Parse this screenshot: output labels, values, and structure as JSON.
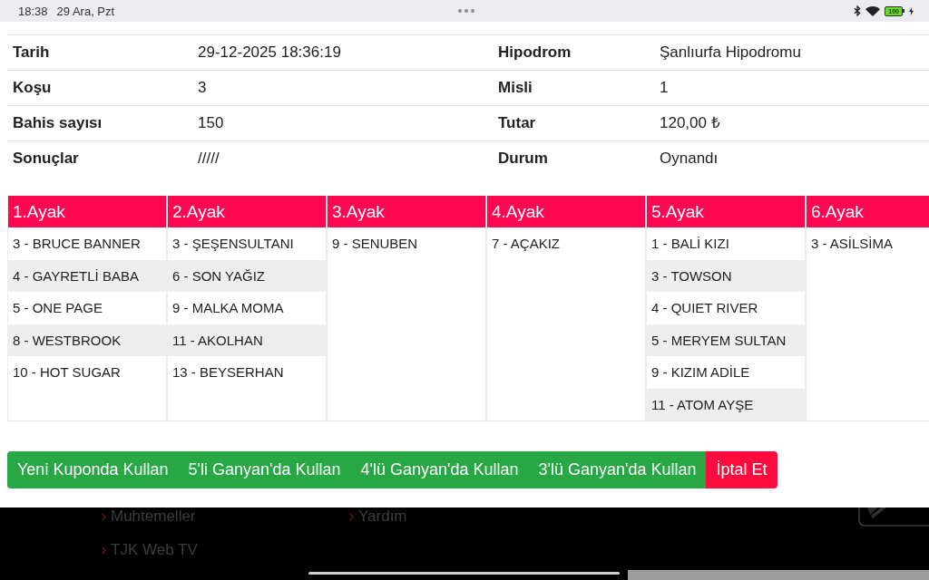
{
  "status_bar": {
    "time": "18:38",
    "date": "29 Ara, Pzt",
    "battery": "100",
    "charging": true
  },
  "details": {
    "rows": [
      {
        "cells": [
          {
            "label": "Tarih",
            "value": "29-12-2025 18:36:19"
          },
          {
            "label": "Hipodrom",
            "value": "Şanlıurfa Hipodromu"
          }
        ]
      },
      {
        "cells": [
          {
            "label": "Koşu",
            "value": "3"
          },
          {
            "label": "Misli",
            "value": "1"
          }
        ]
      },
      {
        "cells": [
          {
            "label": "Bahis sayısı",
            "value": "150"
          },
          {
            "label": "Tutar",
            "value": "120,00 ₺"
          }
        ]
      },
      {
        "cells": [
          {
            "label": "Sonuçlar",
            "value": "/////"
          },
          {
            "label": "Durum",
            "value": "Oynandı"
          }
        ]
      }
    ]
  },
  "legs": [
    {
      "title": "1.Ayak",
      "horses": [
        "3 - BRUCE BANNER",
        "4 - GAYRETLİ BABA",
        "5 - ONE PAGE",
        "8 - WESTBROOK",
        "10 - HOT SUGAR"
      ]
    },
    {
      "title": "2.Ayak",
      "horses": [
        "3 - ŞEŞENSULTANI",
        "6 - SON YAĞIZ",
        "9 - MALKA MOMA",
        "11 - AKOLHAN",
        "13 - BEYSERHAN"
      ]
    },
    {
      "title": "3.Ayak",
      "horses": [
        "9 - SENUBEN"
      ]
    },
    {
      "title": "4.Ayak",
      "horses": [
        "7 - AÇAKIZ"
      ]
    },
    {
      "title": "5.Ayak",
      "horses": [
        "1 - BALİ KIZI",
        "3 - TOWSON",
        "4 - QUIET RIVER",
        "5 - MERYEM SULTAN",
        "9 - KIZIM ADİLE",
        "11 - ATOM AYŞE"
      ]
    },
    {
      "title": "6.Ayak",
      "horses": [
        "3 - ASİLSİMA"
      ]
    }
  ],
  "actions": [
    {
      "label": "Yeni Kuponda Kullan",
      "kind": "primary"
    },
    {
      "label": "5'li Ganyan'da Kullan",
      "kind": "primary"
    },
    {
      "label": "4'lü Ganyan'da Kullan",
      "kind": "primary"
    },
    {
      "label": "3'lü Ganyan'da Kullan",
      "kind": "primary"
    },
    {
      "label": "İptal Et",
      "kind": "danger"
    }
  ],
  "footer": {
    "columns": [
      {
        "links": [
          "Muhtemeller",
          "TJK Web TV"
        ]
      },
      {
        "links": [
          "Yardım"
        ]
      }
    ]
  }
}
